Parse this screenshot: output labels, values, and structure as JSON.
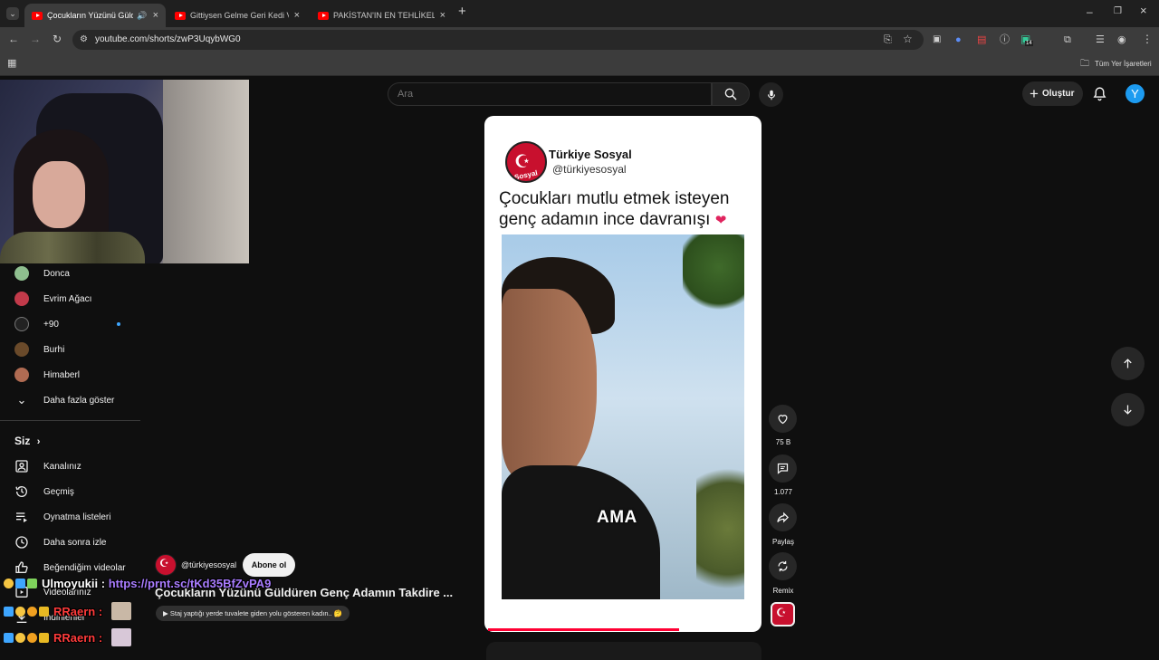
{
  "browser": {
    "tabs": [
      {
        "title": "Çocukların Yüzünü Güldüren Genç",
        "active": true,
        "muted_icon": true
      },
      {
        "title": "Gittiysen Gelme Geri Kedi Versiyonu",
        "active": false
      },
      {
        "title": "PAKİSTAN'IN EN TEHLİKELİ MAHALLESİ",
        "active": false
      }
    ],
    "url": "youtube.com/shorts/zwP3UqybWG0",
    "bookmarks_folder": "Tüm Yer İşaretleri",
    "extension_badge": "14"
  },
  "youtube": {
    "search_placeholder": "Ara",
    "create_label": "Oluştur",
    "avatar_letter": "Y",
    "accent": "#ff0033"
  },
  "sidebar": {
    "subscriptions": [
      {
        "label": "Donca",
        "color": "#8fbf8f"
      },
      {
        "label": "Evrim Ağacı",
        "color": "#c23a4a"
      },
      {
        "label": "+90",
        "color": "#222222"
      },
      {
        "label": "Burhi",
        "color": "#6a4a2a"
      },
      {
        "label": "Himaberl",
        "color": "#b06b52"
      }
    ],
    "show_more": "Daha fazla göster",
    "you_header": "Siz",
    "you_items": [
      {
        "label": "Kanalınız",
        "icon": "channel-icon"
      },
      {
        "label": "Geçmiş",
        "icon": "history-icon"
      },
      {
        "label": "Oynatma listeleri",
        "icon": "playlist-icon"
      },
      {
        "label": "Daha sonra izle",
        "icon": "watch-later-icon"
      },
      {
        "label": "Beğendiğim videolar",
        "icon": "like-icon"
      },
      {
        "label": "Videolarınız",
        "icon": "video-icon"
      },
      {
        "label": "İndirilenler",
        "icon": "download-icon"
      }
    ]
  },
  "short": {
    "card_channel_name": "Türkiye Sosyal",
    "card_handle": "@türkiyesosyal",
    "caption_line1": "Çocukları mutlu etmek isteyen",
    "caption_line2": "genç adamın ince davranışı",
    "caption_emoji": "❤",
    "video_subtitle": "AMA",
    "logo_text": "Sosyal",
    "progress": 0.7,
    "likes": "75 B",
    "comments": "1.077",
    "share_label": "Paylaş",
    "remix_label": "Remix",
    "overlay_handle": "@türkiyesosyal",
    "subscribe_label": "Abone ol",
    "overlay_title": "Çocukların Yüzünü Güldüren Genç Adamın Takdire ...",
    "related_chip": "▶ Staj yaptığı yerde tuvalete giden yolu gösteren kadın.. 🤔"
  },
  "chat": [
    {
      "user": "Ulmoyukii",
      "separator": " : ",
      "message": "https://prnt.sc/tKd35BfZvPA9"
    },
    {
      "user": "RRaern",
      "separator": " : ",
      "message": ""
    },
    {
      "user": "RRaern",
      "separator": " : ",
      "message": ""
    }
  ]
}
